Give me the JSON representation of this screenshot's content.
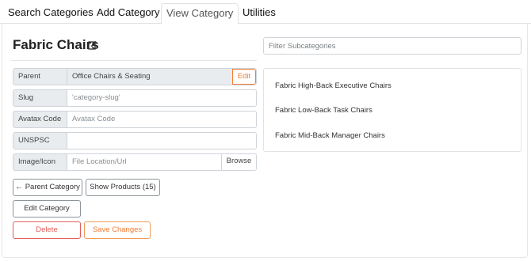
{
  "tabs": [
    {
      "label": "Search Categories"
    },
    {
      "label": "Add Category"
    },
    {
      "label": "View Category"
    },
    {
      "label": "Utilities"
    }
  ],
  "category": {
    "title": "Fabric Chairs"
  },
  "fields": {
    "parent": {
      "label": "Parent",
      "value": "Office Chairs & Seating",
      "button": "Edit"
    },
    "slug": {
      "label": "Slug",
      "placeholder": "'category-slug'"
    },
    "avatax": {
      "label": "Avatax Code",
      "placeholder": "Avatax Code"
    },
    "unspsc": {
      "label": "UNSPSC",
      "placeholder": ""
    },
    "image": {
      "label": "Image/Icon",
      "placeholder": "File Location/Url",
      "button": "Browse"
    }
  },
  "buttons": {
    "parent_category": "Parent Category",
    "show_products": "Show Products (15)",
    "edit_category": "Edit Category",
    "delete": "Delete",
    "save_changes": "Save Changes"
  },
  "subcategories": {
    "filter_placeholder": "Filter Subcategories",
    "items": [
      {
        "label": "Fabric High-Back Executive Chairs"
      },
      {
        "label": "Fabric Low-Back Task Chairs"
      },
      {
        "label": "Fabric Mid-Back Manager Chairs"
      }
    ]
  },
  "icons": {
    "title_edit": "edit-square-icon",
    "back": "arrow-left-icon"
  },
  "colors": {
    "accent": "#f37c3a",
    "danger": "#e35d5d"
  }
}
